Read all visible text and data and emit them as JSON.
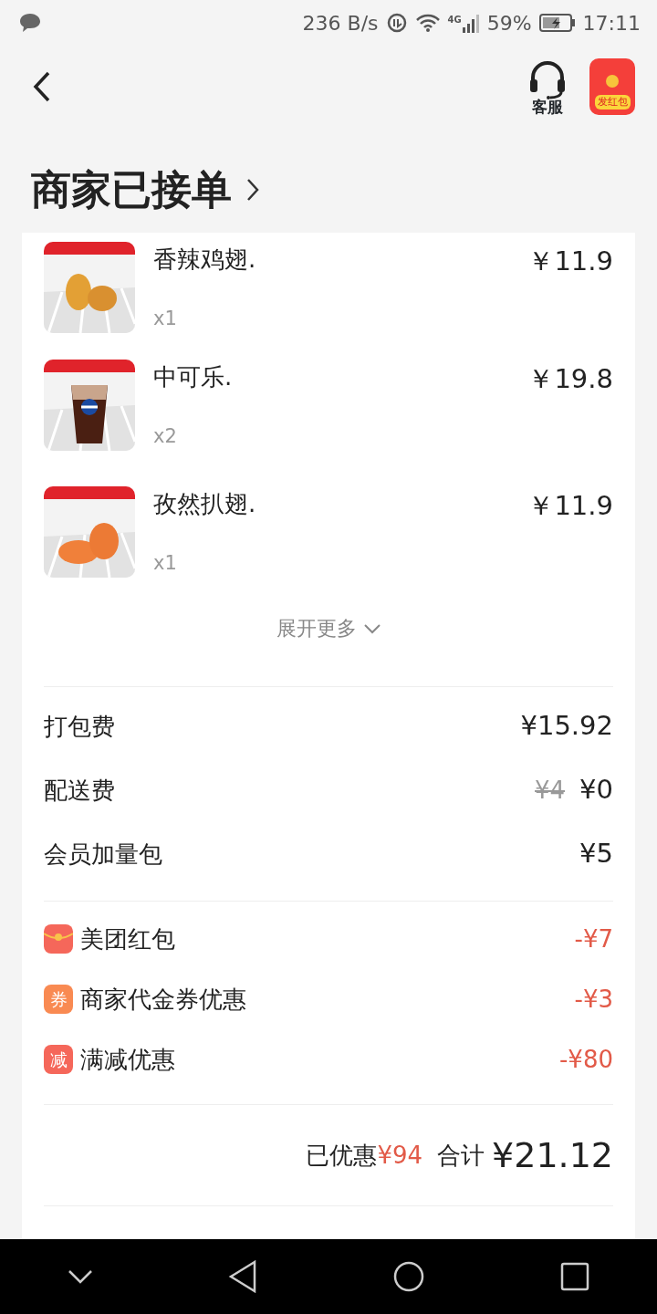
{
  "status_bar": {
    "speed": "236 B/s",
    "network": "4G",
    "battery": "59%",
    "time": "17:11"
  },
  "header": {
    "service_label": "客服",
    "red_packet_label": "发红包"
  },
  "title": "商家已接单",
  "items": [
    {
      "name": "香辣鸡翅.",
      "qty": "x1",
      "price": "￥11.9"
    },
    {
      "name": "中可乐.",
      "qty": "x2",
      "price": "￥19.8"
    },
    {
      "name": "孜然扒翅.",
      "qty": "x1",
      "price": "￥11.9"
    }
  ],
  "expand_more": "展开更多",
  "fees": [
    {
      "label": "打包费",
      "price": "¥15.92"
    },
    {
      "label": "配送费",
      "original_price": "¥4",
      "price": "¥0"
    },
    {
      "label": "会员加量包",
      "price": "¥5"
    }
  ],
  "discounts": [
    {
      "kind": "packet",
      "label": "美团红包",
      "amount": "-¥7",
      "color": "#f5675a"
    },
    {
      "kind": "badge",
      "badge": "券",
      "label": "商家代金券优惠",
      "amount": "-¥3",
      "color": "#f98a52"
    },
    {
      "kind": "badge",
      "badge": "减",
      "label": "满减优惠",
      "amount": "-¥80",
      "color": "#f5675a"
    }
  ],
  "summary": {
    "saved_label": "已优惠",
    "saved_amount": "¥94",
    "total_label": "合计",
    "total": "¥21.12"
  }
}
